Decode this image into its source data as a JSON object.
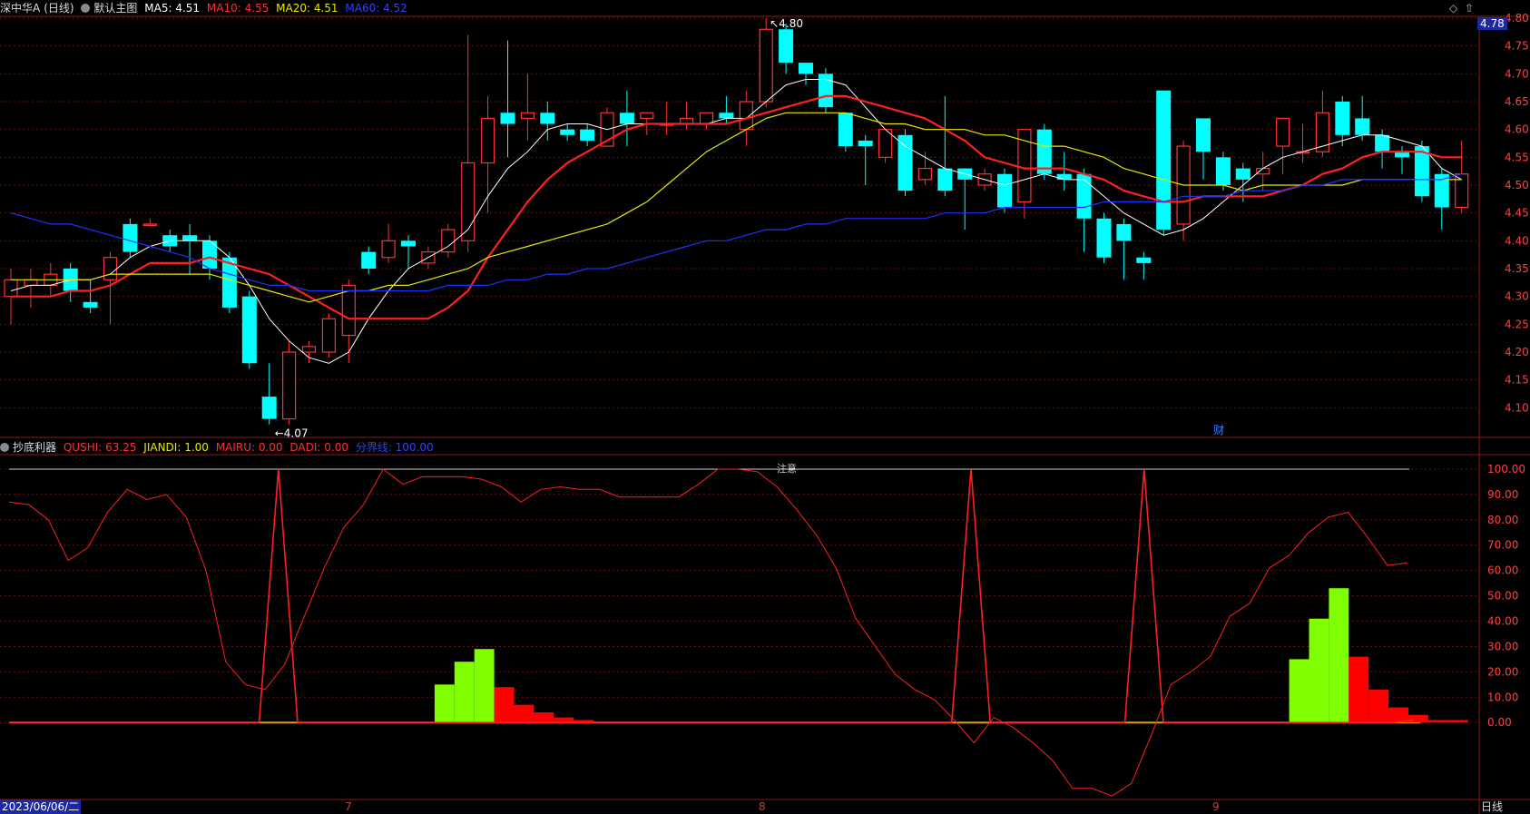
{
  "header": {
    "stock_name": "深中华A",
    "period": "(日线)",
    "main_chart_label": "默认主图",
    "ma5": "MA5: 4.51",
    "ma10": "MA10: 4.55",
    "ma20": "MA20: 4.51",
    "ma60": "MA60: 4.52",
    "current_price": "4.78",
    "max_annot": "4.80",
    "min_annot": "←4.07",
    "cai_marker": "财"
  },
  "indicator_header": {
    "name": "抄底利器",
    "qushi": "QUSHI: 63.25",
    "jiandi": "JIANDI: 1.00",
    "mairu": "MAIRU: 0.00",
    "dadi": "DADI: 0.00",
    "fenjie": "分界线: 100.00",
    "top_marker": "注意"
  },
  "bottom_bar": {
    "date": "2023/06/06/二",
    "month_7": "7",
    "month_8": "8",
    "month_9": "9",
    "period_button": "日线"
  },
  "colors": {
    "up": "#ff3232",
    "down": "#00ffff",
    "ma5": "#ffffff",
    "ma10": "#ff2020",
    "ma20": "#e8e800",
    "ma60": "#1e32ff",
    "qushi": "#ff2020",
    "jiandi": "#80ff00",
    "mairu": "#ff0000",
    "grid": "#6a1010",
    "price_badge": "#1e28a0"
  },
  "chart_data": [
    {
      "type": "candlestick",
      "title": "深中华A (日线)",
      "y_ticks": [
        "4.80",
        "4.75",
        "4.70",
        "4.65",
        "4.60",
        "4.55",
        "4.50",
        "4.45",
        "4.40",
        "4.35",
        "4.30",
        "4.25",
        "4.20",
        "4.15",
        "4.10"
      ],
      "ylim": [
        4.05,
        4.8
      ],
      "x_labels": [
        "7",
        "8",
        "9"
      ],
      "candles_ohlc": [
        [
          4.3,
          4.33,
          4.25,
          4.35
        ],
        [
          4.32,
          4.33,
          4.28,
          4.35
        ],
        [
          4.32,
          4.34,
          4.3,
          4.36
        ],
        [
          4.35,
          4.31,
          4.29,
          4.36
        ],
        [
          4.29,
          4.28,
          4.27,
          4.33
        ],
        [
          4.33,
          4.37,
          4.25,
          4.38
        ],
        [
          4.43,
          4.38,
          4.37,
          4.44
        ],
        [
          4.43,
          4.43,
          4.43,
          4.44
        ],
        [
          4.41,
          4.39,
          4.38,
          4.42
        ],
        [
          4.41,
          4.4,
          4.34,
          4.43
        ],
        [
          4.4,
          4.35,
          4.33,
          4.41
        ],
        [
          4.37,
          4.28,
          4.27,
          4.38
        ],
        [
          4.3,
          4.18,
          4.17,
          4.31
        ],
        [
          4.12,
          4.08,
          4.07,
          4.18
        ],
        [
          4.08,
          4.2,
          4.07,
          4.22
        ],
        [
          4.2,
          4.21,
          4.18,
          4.22
        ],
        [
          4.2,
          4.26,
          4.19,
          4.27
        ],
        [
          4.23,
          4.32,
          4.18,
          4.33
        ],
        [
          4.38,
          4.35,
          4.34,
          4.39
        ],
        [
          4.37,
          4.4,
          4.36,
          4.43
        ],
        [
          4.4,
          4.39,
          4.35,
          4.41
        ],
        [
          4.36,
          4.38,
          4.35,
          4.39
        ],
        [
          4.38,
          4.42,
          4.37,
          4.43
        ],
        [
          4.4,
          4.54,
          4.38,
          4.77
        ],
        [
          4.54,
          4.62,
          4.45,
          4.66
        ],
        [
          4.63,
          4.61,
          4.55,
          4.76
        ],
        [
          4.62,
          4.63,
          4.58,
          4.7
        ],
        [
          4.63,
          4.61,
          4.58,
          4.65
        ],
        [
          4.6,
          4.59,
          4.58,
          4.61
        ],
        [
          4.6,
          4.58,
          4.57,
          4.61
        ],
        [
          4.57,
          4.63,
          4.57,
          4.64
        ],
        [
          4.63,
          4.61,
          4.57,
          4.67
        ],
        [
          4.62,
          4.63,
          4.59,
          4.63
        ],
        [
          4.61,
          4.61,
          4.59,
          4.65
        ],
        [
          4.61,
          4.62,
          4.6,
          4.65
        ],
        [
          4.61,
          4.63,
          4.6,
          4.63
        ],
        [
          4.63,
          4.62,
          4.61,
          4.66
        ],
        [
          4.6,
          4.65,
          4.57,
          4.67
        ],
        [
          4.65,
          4.78,
          4.64,
          4.8
        ],
        [
          4.78,
          4.72,
          4.7,
          4.79
        ],
        [
          4.72,
          4.7,
          4.68,
          4.72
        ],
        [
          4.7,
          4.64,
          4.63,
          4.71
        ],
        [
          4.63,
          4.57,
          4.56,
          4.63
        ],
        [
          4.58,
          4.57,
          4.5,
          4.59
        ],
        [
          4.55,
          4.6,
          4.54,
          4.6
        ],
        [
          4.59,
          4.49,
          4.48,
          4.6
        ],
        [
          4.51,
          4.53,
          4.5,
          4.56
        ],
        [
          4.53,
          4.49,
          4.48,
          4.66
        ],
        [
          4.53,
          4.51,
          4.42,
          4.53
        ],
        [
          4.5,
          4.52,
          4.49,
          4.53
        ],
        [
          4.52,
          4.46,
          4.45,
          4.53
        ],
        [
          4.47,
          4.6,
          4.44,
          4.6
        ],
        [
          4.6,
          4.52,
          4.51,
          4.61
        ],
        [
          4.52,
          4.51,
          4.49,
          4.56
        ],
        [
          4.52,
          4.44,
          4.38,
          4.53
        ],
        [
          4.44,
          4.37,
          4.36,
          4.45
        ],
        [
          4.43,
          4.4,
          4.33,
          4.44
        ],
        [
          4.37,
          4.36,
          4.33,
          4.38
        ],
        [
          4.67,
          4.42,
          4.41,
          4.67
        ],
        [
          4.43,
          4.57,
          4.4,
          4.58
        ],
        [
          4.62,
          4.56,
          4.51,
          4.62
        ],
        [
          4.55,
          4.5,
          4.49,
          4.56
        ],
        [
          4.53,
          4.51,
          4.47,
          4.54
        ],
        [
          4.52,
          4.53,
          4.49,
          4.56
        ],
        [
          4.57,
          4.62,
          4.52,
          4.62
        ],
        [
          4.56,
          4.56,
          4.54,
          4.61
        ],
        [
          4.56,
          4.63,
          4.55,
          4.67
        ],
        [
          4.65,
          4.59,
          4.57,
          4.66
        ],
        [
          4.62,
          4.59,
          4.58,
          4.66
        ],
        [
          4.59,
          4.56,
          4.53,
          4.6
        ],
        [
          4.56,
          4.55,
          4.52,
          4.57
        ],
        [
          4.57,
          4.48,
          4.47,
          4.58
        ],
        [
          4.52,
          4.46,
          4.42,
          4.53
        ],
        [
          4.46,
          4.52,
          4.45,
          4.58
        ]
      ],
      "series": [
        {
          "name": "MA5",
          "values": [
            4.31,
            4.32,
            4.32,
            4.33,
            4.33,
            4.34,
            4.37,
            4.39,
            4.4,
            4.4,
            4.4,
            4.37,
            4.32,
            4.26,
            4.22,
            4.19,
            4.18,
            4.2,
            4.26,
            4.31,
            4.35,
            4.37,
            4.39,
            4.42,
            4.48,
            4.53,
            4.56,
            4.6,
            4.61,
            4.61,
            4.6,
            4.61,
            4.61,
            4.61,
            4.61,
            4.61,
            4.62,
            4.62,
            4.65,
            4.68,
            4.69,
            4.69,
            4.68,
            4.64,
            4.6,
            4.57,
            4.55,
            4.53,
            4.52,
            4.51,
            4.5,
            4.51,
            4.52,
            4.51,
            4.51,
            4.48,
            4.45,
            4.43,
            4.41,
            4.42,
            4.44,
            4.47,
            4.5,
            4.53,
            4.55,
            4.56,
            4.57,
            4.58,
            4.59,
            4.59,
            4.58,
            4.57,
            4.53,
            4.51
          ]
        },
        {
          "name": "MA10",
          "values": [
            4.3,
            4.3,
            4.3,
            4.31,
            4.31,
            4.32,
            4.34,
            4.36,
            4.36,
            4.36,
            4.37,
            4.36,
            4.35,
            4.34,
            4.32,
            4.3,
            4.28,
            4.26,
            4.26,
            4.26,
            4.26,
            4.26,
            4.28,
            4.31,
            4.37,
            4.42,
            4.47,
            4.51,
            4.54,
            4.56,
            4.58,
            4.6,
            4.61,
            4.61,
            4.61,
            4.61,
            4.61,
            4.62,
            4.63,
            4.64,
            4.65,
            4.66,
            4.66,
            4.65,
            4.64,
            4.63,
            4.62,
            4.6,
            4.58,
            4.55,
            4.54,
            4.53,
            4.53,
            4.53,
            4.52,
            4.51,
            4.49,
            4.48,
            4.47,
            4.47,
            4.48,
            4.48,
            4.48,
            4.48,
            4.49,
            4.5,
            4.52,
            4.53,
            4.55,
            4.56,
            4.56,
            4.56,
            4.55,
            4.55
          ]
        },
        {
          "name": "MA20",
          "values": [
            4.33,
            4.33,
            4.33,
            4.33,
            4.33,
            4.34,
            4.34,
            4.34,
            4.34,
            4.34,
            4.34,
            4.33,
            4.32,
            4.31,
            4.3,
            4.29,
            4.3,
            4.31,
            4.31,
            4.32,
            4.32,
            4.33,
            4.34,
            4.35,
            4.37,
            4.38,
            4.39,
            4.4,
            4.41,
            4.42,
            4.43,
            4.45,
            4.47,
            4.5,
            4.53,
            4.56,
            4.58,
            4.6,
            4.62,
            4.63,
            4.63,
            4.63,
            4.63,
            4.62,
            4.61,
            4.61,
            4.6,
            4.6,
            4.6,
            4.59,
            4.59,
            4.58,
            4.57,
            4.57,
            4.56,
            4.55,
            4.53,
            4.52,
            4.51,
            4.5,
            4.5,
            4.5,
            4.49,
            4.5,
            4.5,
            4.5,
            4.5,
            4.5,
            4.51,
            4.51,
            4.51,
            4.51,
            4.51,
            4.51
          ]
        },
        {
          "name": "MA60",
          "values": [
            4.45,
            4.44,
            4.43,
            4.43,
            4.42,
            4.41,
            4.4,
            4.39,
            4.38,
            4.37,
            4.35,
            4.34,
            4.33,
            4.32,
            4.32,
            4.31,
            4.31,
            4.31,
            4.31,
            4.31,
            4.31,
            4.31,
            4.32,
            4.32,
            4.32,
            4.33,
            4.33,
            4.34,
            4.34,
            4.35,
            4.35,
            4.36,
            4.37,
            4.38,
            4.39,
            4.4,
            4.4,
            4.41,
            4.42,
            4.42,
            4.43,
            4.43,
            4.44,
            4.44,
            4.44,
            4.44,
            4.44,
            4.45,
            4.45,
            4.45,
            4.46,
            4.46,
            4.46,
            4.46,
            4.46,
            4.47,
            4.47,
            4.47,
            4.47,
            4.48,
            4.48,
            4.48,
            4.49,
            4.49,
            4.49,
            4.5,
            4.5,
            4.51,
            4.51,
            4.51,
            4.51,
            4.51,
            4.51,
            4.52
          ]
        }
      ]
    },
    {
      "type": "bar",
      "title": "抄底利器",
      "y_ticks": [
        "100.00",
        "90.00",
        "80.00",
        "70.00",
        "60.00",
        "50.00",
        "40.00",
        "30.00",
        "20.00",
        "10.00",
        "0.00"
      ],
      "ylim": [
        -30,
        105
      ],
      "series": [
        {
          "name": "QUSHI",
          "values": [
            87,
            86,
            80,
            64,
            69,
            83,
            92,
            88,
            90,
            81,
            60,
            24,
            15,
            13,
            23,
            42,
            61,
            77,
            86,
            100,
            94,
            97,
            97,
            97,
            96,
            93,
            87,
            92,
            93,
            92,
            92,
            89,
            89,
            89,
            89,
            94,
            100,
            100,
            99,
            93,
            84,
            74,
            61,
            41,
            30,
            19,
            13,
            9,
            1,
            -8,
            2,
            -2,
            -8,
            -15,
            -26,
            -26,
            -29,
            -24,
            -5,
            15,
            20,
            26,
            42,
            47,
            61,
            66,
            75,
            81,
            83,
            73,
            62,
            63
          ]
        },
        {
          "name": "JIANDI",
          "values": [
            0,
            0,
            0,
            0,
            0,
            0,
            0,
            0,
            0,
            0,
            0,
            0,
            0,
            0,
            100,
            0,
            0,
            0,
            0,
            0,
            0,
            0,
            0,
            0,
            0,
            0,
            0,
            0,
            0,
            0,
            0,
            0,
            0,
            0,
            0,
            0,
            0,
            0,
            0,
            0,
            0,
            0,
            0,
            0,
            0,
            0,
            0,
            0,
            0,
            0,
            100,
            0,
            0,
            0,
            0,
            0,
            0,
            0,
            0,
            100,
            0,
            0,
            0,
            0,
            0,
            0,
            0,
            0,
            0,
            0,
            0,
            0,
            0,
            1
          ]
        },
        {
          "name": "MAIRU",
          "values": [
            0,
            0,
            0,
            0,
            0,
            0,
            0,
            0,
            0,
            0,
            0,
            15,
            24,
            29,
            0,
            0,
            0,
            0,
            0,
            0,
            0,
            0,
            0,
            0,
            0,
            0,
            0,
            0,
            0,
            0,
            0,
            0,
            0,
            0,
            0,
            0,
            0,
            0,
            0,
            0,
            0,
            0,
            0,
            0,
            0,
            0,
            0,
            0,
            0,
            0,
            0,
            0,
            0,
            0,
            25,
            41,
            53,
            0,
            0,
            0,
            0,
            0,
            0,
            0,
            0,
            0,
            0,
            0,
            0,
            0,
            0,
            0,
            0,
            0
          ]
        },
        {
          "name": "DADI",
          "values": [
            0,
            0,
            0,
            0,
            0,
            0,
            0,
            0,
            0,
            0,
            0,
            0,
            0,
            0,
            14,
            7,
            4,
            2,
            1,
            0,
            0,
            0,
            0,
            0,
            0,
            0,
            0,
            0,
            0,
            0,
            0,
            0,
            0,
            0,
            0,
            0,
            0,
            0,
            0,
            0,
            0,
            0,
            0,
            0,
            0,
            0,
            0,
            0,
            0,
            0,
            0,
            0,
            0,
            0,
            0,
            0,
            0,
            26,
            13,
            6,
            3,
            1,
            1,
            0,
            0,
            0,
            0,
            0,
            0,
            0,
            0,
            0,
            0,
            0
          ]
        },
        {
          "name": "分界线",
          "values": [
            100
          ]
        }
      ]
    }
  ]
}
